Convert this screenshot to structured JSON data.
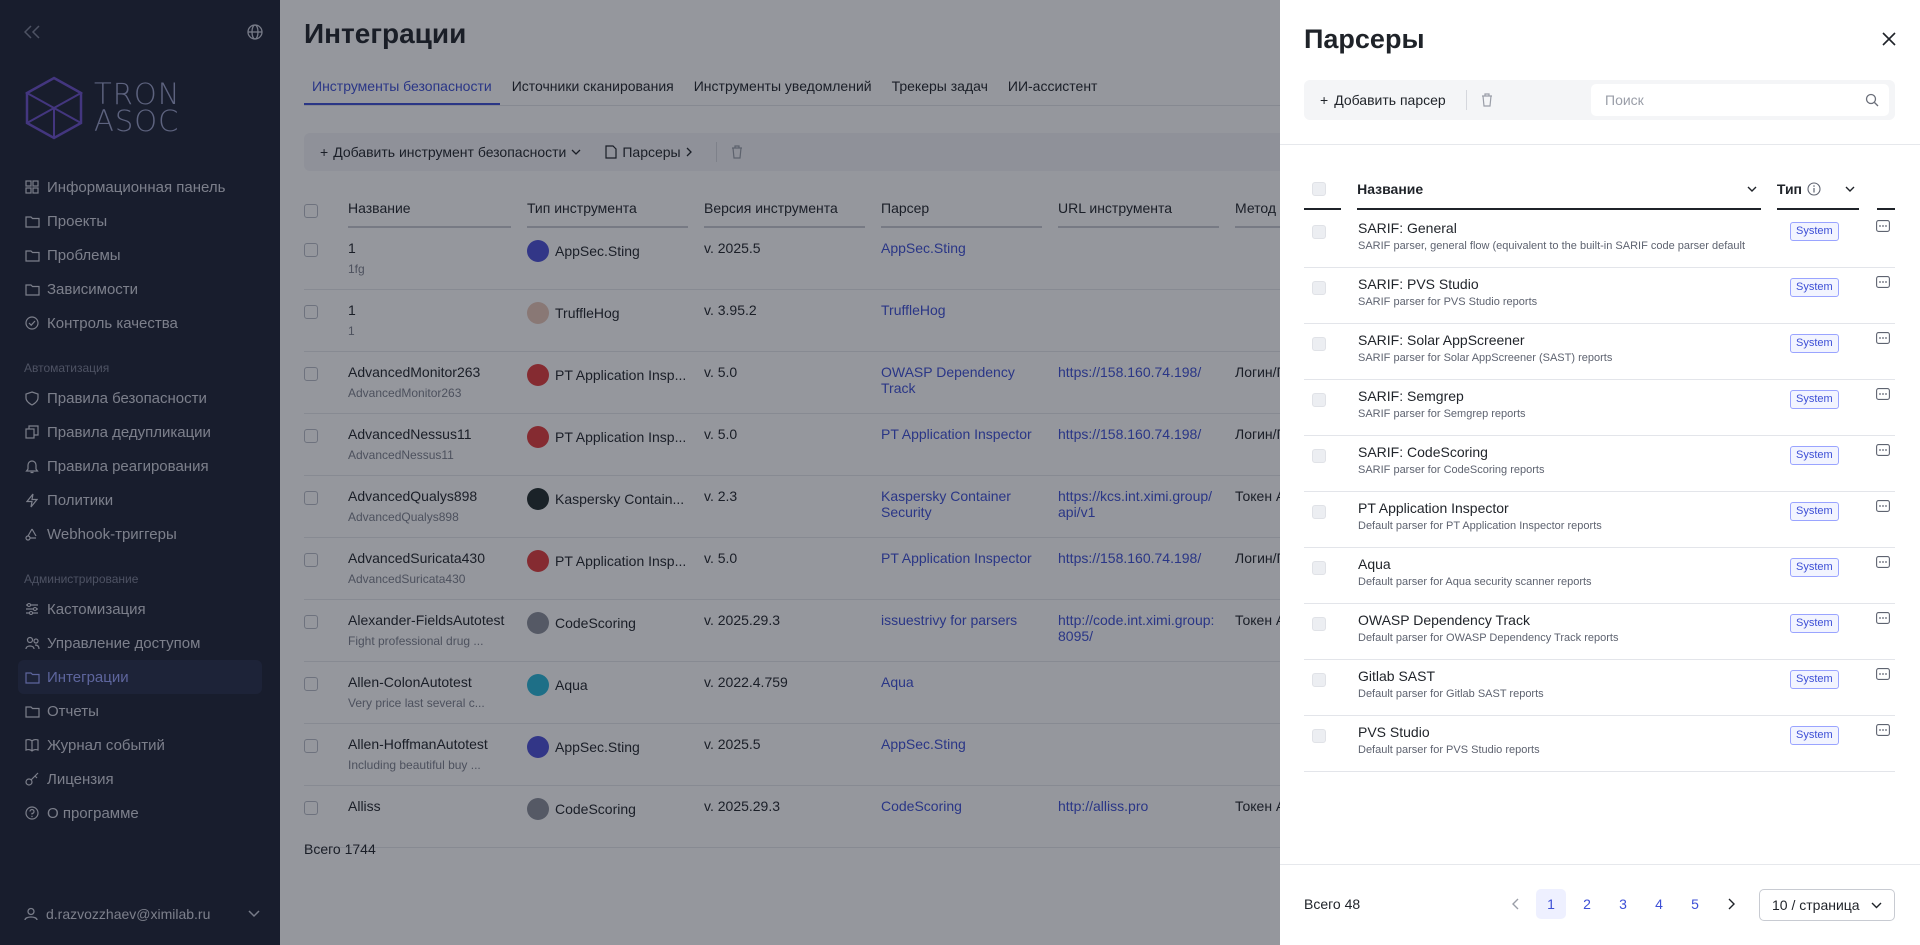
{
  "sidebar": {
    "logo_text_1": "TRON",
    "logo_text_2": "ASOC",
    "items_main": [
      {
        "label": "Информационная панель",
        "icon": "dashboard-icon"
      },
      {
        "label": "Проекты",
        "icon": "folder-icon"
      },
      {
        "label": "Проблемы",
        "icon": "folder-icon"
      },
      {
        "label": "Зависимости",
        "icon": "folder-icon"
      },
      {
        "label": "Контроль качества",
        "icon": "check-circle-icon"
      }
    ],
    "section_automation": "Автоматизация",
    "items_automation": [
      {
        "label": "Правила безопасности",
        "icon": "shield-icon"
      },
      {
        "label": "Правила дедупликации",
        "icon": "duplicate-icon"
      },
      {
        "label": "Правила реагирования",
        "icon": "bell-icon"
      },
      {
        "label": "Политики",
        "icon": "lightning-icon"
      },
      {
        "label": "Webhook-триггеры",
        "icon": "webhook-icon"
      }
    ],
    "section_admin": "Администрирование",
    "items_admin": [
      {
        "label": "Кастомизация",
        "icon": "sliders-icon"
      },
      {
        "label": "Управление доступом",
        "icon": "users-icon"
      },
      {
        "label": "Интеграции",
        "icon": "folder-icon",
        "active": true
      },
      {
        "label": "Отчеты",
        "icon": "folder-icon"
      },
      {
        "label": "Журнал событий",
        "icon": "book-icon"
      },
      {
        "label": "Лицензия",
        "icon": "key-icon"
      },
      {
        "label": "О программе",
        "icon": "question-icon"
      }
    ],
    "user": "d.razvozzhaev@ximilab.ru"
  },
  "main": {
    "title": "Интеграции",
    "tabs": [
      "Инструменты безопасности",
      "Источники сканирования",
      "Инструменты уведомлений",
      "Трекеры задач",
      "ИИ-ассистент"
    ],
    "toolbar": {
      "add_tool": "Добавить инструмент безопасности",
      "parsers": "Парсеры"
    },
    "columns": [
      "Название",
      "Тип инструмента",
      "Версия инструмента",
      "Парсер",
      "URL инструмента",
      "Метод а"
    ],
    "rows": [
      {
        "name": "1",
        "sub": "1fg",
        "tool": "AppSec.Sting",
        "tool_color": "#4b4fd8",
        "version": "v. 2025.5",
        "parser": "AppSec.Sting",
        "url": "",
        "method": ""
      },
      {
        "name": "1",
        "sub": "1",
        "tool": "TruffleHog",
        "tool_color": "#e9c6b7",
        "version": "v. 3.95.2",
        "parser": "TruffleHog",
        "url": "",
        "method": ""
      },
      {
        "name": "AdvancedMonitor263",
        "sub": "AdvancedMonitor263",
        "tool": "PT Application Insp...",
        "tool_color": "#e23b3b",
        "version": "v. 5.0",
        "parser": "OWASP Dependency Track",
        "url": "https://158.160.74.198/",
        "method": "Логин/П"
      },
      {
        "name": "AdvancedNessus11",
        "sub": "AdvancedNessus11",
        "tool": "PT Application Insp...",
        "tool_color": "#e23b3b",
        "version": "v. 5.0",
        "parser": "PT Application Inspector",
        "url": "https://158.160.74.198/",
        "method": "Логин/П"
      },
      {
        "name": "AdvancedQualys898",
        "sub": "AdvancedQualys898",
        "tool": "Kaspersky Contain...",
        "tool_color": "#1f2a2a",
        "version": "v. 2.3",
        "parser": "Kaspersky Container Security",
        "url": "https://kcs.int.ximi.group/api/v1",
        "method": "Токен А"
      },
      {
        "name": "AdvancedSuricata430",
        "sub": "AdvancedSuricata430",
        "tool": "PT Application Insp...",
        "tool_color": "#e23b3b",
        "version": "v. 5.0",
        "parser": "PT Application Inspector",
        "url": "https://158.160.74.198/",
        "method": "Логин/П"
      },
      {
        "name": "Alexander-FieldsAutotest",
        "sub": "Fight professional drug ...",
        "tool": "CodeScoring",
        "tool_color": "#8a8f9a",
        "version": "v. 2025.29.3",
        "parser": "issuestrivy for parsers",
        "url": "http://code.int.ximi.group:8095/",
        "method": "Токен А"
      },
      {
        "name": "Allen-ColonAutotest",
        "sub": "Very price last several c...",
        "tool": "Aqua",
        "tool_color": "#27b6d8",
        "version": "v. 2022.4.759",
        "parser": "Aqua",
        "url": "",
        "method": ""
      },
      {
        "name": "Allen-HoffmanAutotest",
        "sub": "Including beautiful buy ...",
        "tool": "AppSec.Sting",
        "tool_color": "#4b4fd8",
        "version": "v. 2025.5",
        "parser": "AppSec.Sting",
        "url": "",
        "method": ""
      },
      {
        "name": "Alliss",
        "sub": "",
        "tool": "CodeScoring",
        "tool_color": "#8a8f9a",
        "version": "v. 2025.29.3",
        "parser": "CodeScoring",
        "url": "http://alliss.pro",
        "method": "Токен А"
      }
    ],
    "total": "Всего 1744"
  },
  "drawer": {
    "title": "Парсеры",
    "add_label": "Добавить парсер",
    "search_placeholder": "Поиск",
    "col_name": "Название",
    "col_type": "Тип",
    "parsers": [
      {
        "name": "SARIF: General",
        "desc": "SARIF parser, general flow (equivalent to the built-in SARIF code parser default",
        "type": "System"
      },
      {
        "name": "SARIF: PVS Studio",
        "desc": "SARIF parser for PVS Studio reports",
        "type": "System"
      },
      {
        "name": "SARIF: Solar AppScreener",
        "desc": "SARIF parser for Solar AppScreener (SAST) reports",
        "type": "System"
      },
      {
        "name": "SARIF: Semgrep",
        "desc": "SARIF parser for Semgrep reports",
        "type": "System"
      },
      {
        "name": "SARIF: CodeScoring",
        "desc": "SARIF parser for CodeScoring reports",
        "type": "System"
      },
      {
        "name": "PT Application Inspector",
        "desc": "Default parser for PT Application Inspector reports",
        "type": "System"
      },
      {
        "name": "Aqua",
        "desc": "Default parser for Aqua security scanner reports",
        "type": "System"
      },
      {
        "name": "OWASP Dependency Track",
        "desc": "Default parser for OWASP Dependency Track reports",
        "type": "System"
      },
      {
        "name": "Gitlab SAST",
        "desc": "Default parser for Gitlab SAST reports",
        "type": "System"
      },
      {
        "name": "PVS Studio",
        "desc": "Default parser for PVS Studio reports",
        "type": "System"
      }
    ],
    "total": "Всего 48",
    "pages": [
      "1",
      "2",
      "3",
      "4",
      "5"
    ],
    "current_page": "1",
    "page_size": "10 / страница"
  },
  "colors": {
    "accent": "#3d4fd6",
    "sidebar_bg": "#1d2133",
    "active_bg": "#262c47"
  }
}
